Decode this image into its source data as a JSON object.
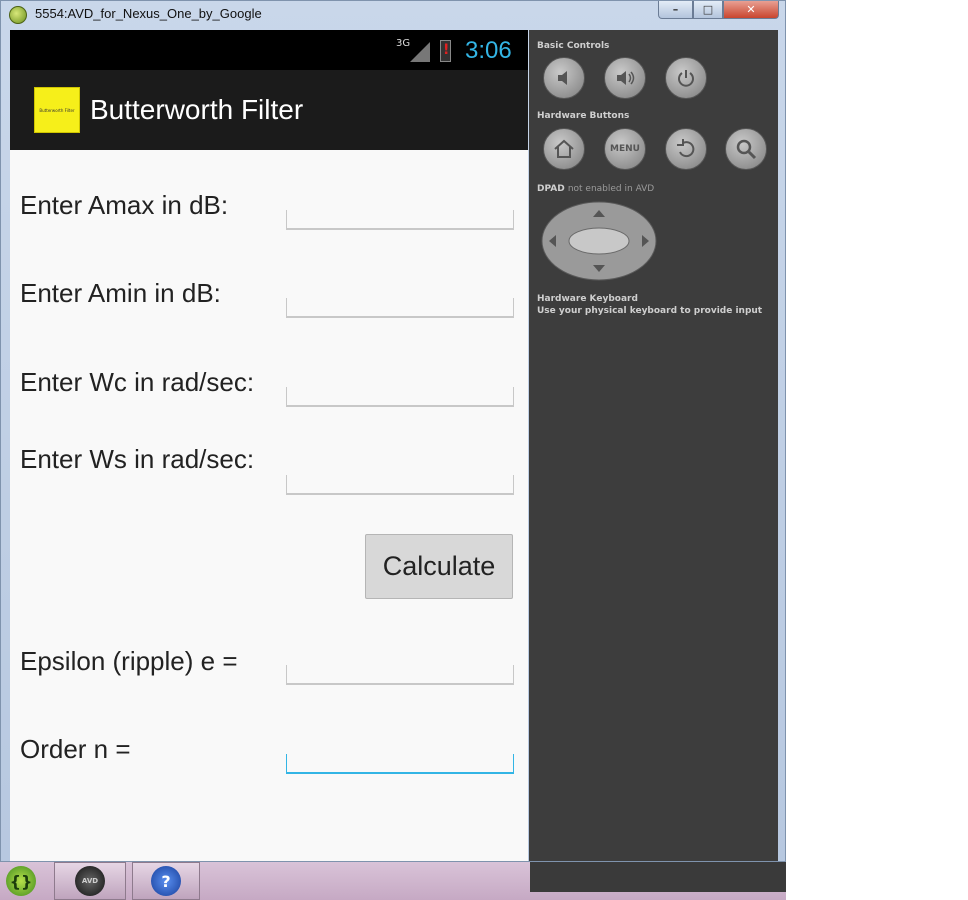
{
  "window": {
    "title": "5554:AVD_for_Nexus_One_by_Google"
  },
  "status_bar": {
    "network": "3G",
    "time": "3:06"
  },
  "app": {
    "title": "Butterworth Filter",
    "logo_text": "Butterworth Filter"
  },
  "form": {
    "amax_label": "Enter Amax in dB:",
    "amin_label": "Enter Amin in dB:",
    "wc_label": "Enter Wc in rad/sec:",
    "ws_label": "Enter Ws in rad/sec:",
    "calculate_label": "Calculate",
    "epsilon_label": "Epsilon (ripple) e =",
    "order_label": "Order n ="
  },
  "controls": {
    "basic_heading": "Basic Controls",
    "hardware_heading": "Hardware Buttons",
    "menu_label": "MENU",
    "dpad_heading": "DPAD",
    "dpad_status": "not enabled in AVD",
    "keyboard_heading": "Hardware Keyboard",
    "keyboard_hint": "Use your physical keyboard to provide input"
  },
  "taskbar": {
    "item2_label": "AVD"
  },
  "colors": {
    "accent": "#33b5e5",
    "action_bar": "#1b1b1b",
    "logo": "#f6ef1a",
    "panel": "#3d3d3d"
  }
}
